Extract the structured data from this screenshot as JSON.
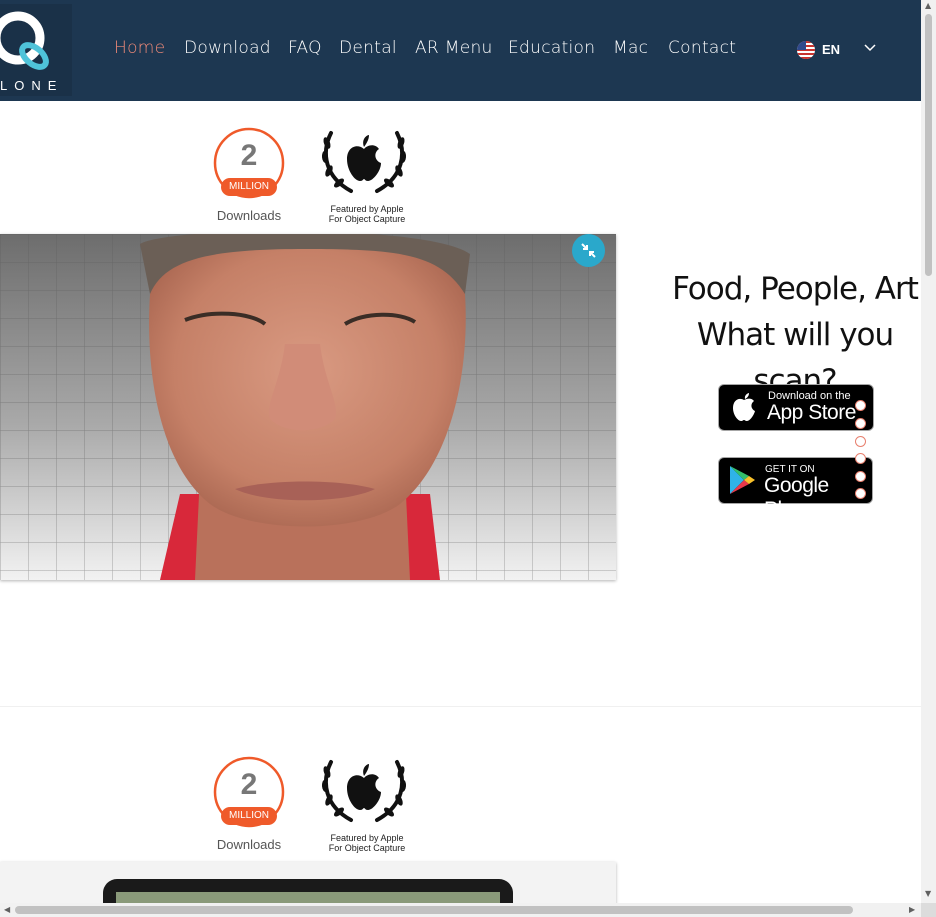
{
  "header": {
    "logo_text": "LONE",
    "nav": [
      "Home",
      "Download",
      "FAQ",
      "Dental",
      "AR Menu",
      "Education",
      "Mac",
      "Contact"
    ],
    "active_nav": "Home",
    "language": "EN"
  },
  "badges": {
    "million_number": "2",
    "million_label": "MILLION",
    "downloads_label": "Downloads",
    "featured_line1": "Featured by Apple",
    "featured_line2": "For Object Capture"
  },
  "hero": {
    "headline_line1": "Food, People, Art",
    "headline_line2": "What will you scan?"
  },
  "stores": {
    "appstore_small": "Download on the",
    "appstore_big": "App Store",
    "googleplay_small": "GET IT ON",
    "googleplay_big": "Google Play"
  },
  "colors": {
    "header_bg": "#1d3751",
    "accent": "#f08a78",
    "badge_orange": "#ef5a2a",
    "expand_button": "#2aa8cb"
  },
  "icons": [
    "q-logo-icon",
    "us-flag-icon",
    "chevron-down-icon",
    "apple-wreath-icon",
    "compress-icon",
    "apple-icon",
    "google-play-icon"
  ]
}
